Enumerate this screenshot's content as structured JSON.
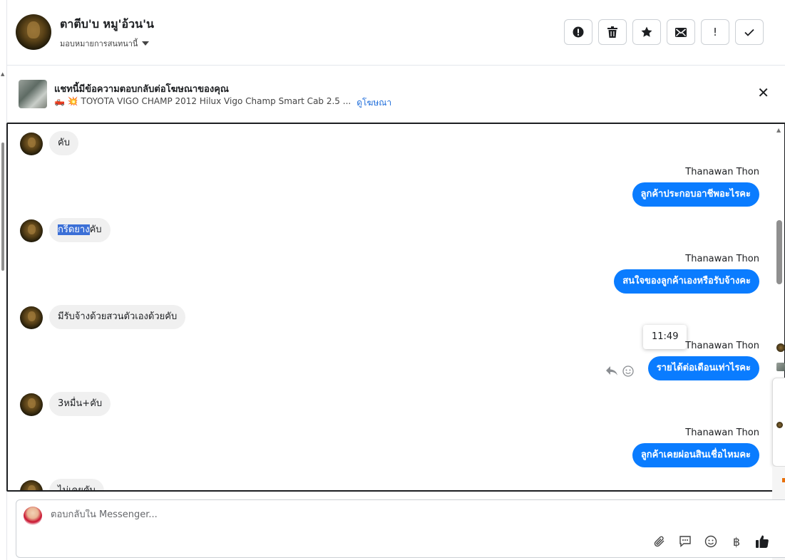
{
  "header": {
    "contact_name": "ตาตีบ'บ หมู'อ้วน'น",
    "assign_label": "มอบหมายการสนทนานี้",
    "actions": [
      {
        "name": "report-icon",
        "glyph": "❗"
      },
      {
        "name": "trash-icon",
        "glyph": "🗑"
      },
      {
        "name": "star-icon",
        "glyph": "★"
      },
      {
        "name": "envelope-icon",
        "glyph": "✉"
      },
      {
        "name": "exclamation-icon",
        "glyph": "!"
      },
      {
        "name": "check-icon",
        "glyph": "✓"
      }
    ]
  },
  "ad_banner": {
    "title": "แชทนี้มีข้อความตอบกลับต่อโฆษณาของคุณ",
    "subtitle": "🛻 💥 TOYOTA VIGO CHAMP 2012 Hilux Vigo Champ Smart Cab 2.5 ...",
    "link": "ดูโฆษณา",
    "close": "✕"
  },
  "messages": {
    "m1": "คับ",
    "m2_sender": "Thanawan Thon",
    "m2": "ลูกค้าประกอบอาชีพอะไรคะ",
    "m3_highlight": "กรีดยาง",
    "m3_rest": "คับ",
    "m4_sender": "Thanawan Thon",
    "m4": "สนใจของลูกค้าเองหรือรับจ้างคะ",
    "m5": "มีรับจ้างด้วยสวนตัวเองด้วยคับ",
    "m6_sender": "Thanawan Thon",
    "m6": "รายได้ต่อเดือนเท่าไรคะ",
    "m6_time": "11:49",
    "m7": "3หมื่น+คับ",
    "m8_sender": "Thanawan Thon",
    "m8": "ลูกค้าเคยผ่อนสินเชื่อไหมคะ",
    "m9": "ไม่เคยคับ"
  },
  "composer": {
    "placeholder": "ตอบกลับใน Messenger...",
    "tools": [
      {
        "name": "paperclip-icon",
        "glyph": "📎"
      },
      {
        "name": "saved-reply-icon",
        "glyph": "💬"
      },
      {
        "name": "emoji-icon",
        "glyph": "☺"
      },
      {
        "name": "baht-icon",
        "glyph": "฿"
      },
      {
        "name": "thumbs-up-icon",
        "glyph": "👍"
      }
    ]
  }
}
